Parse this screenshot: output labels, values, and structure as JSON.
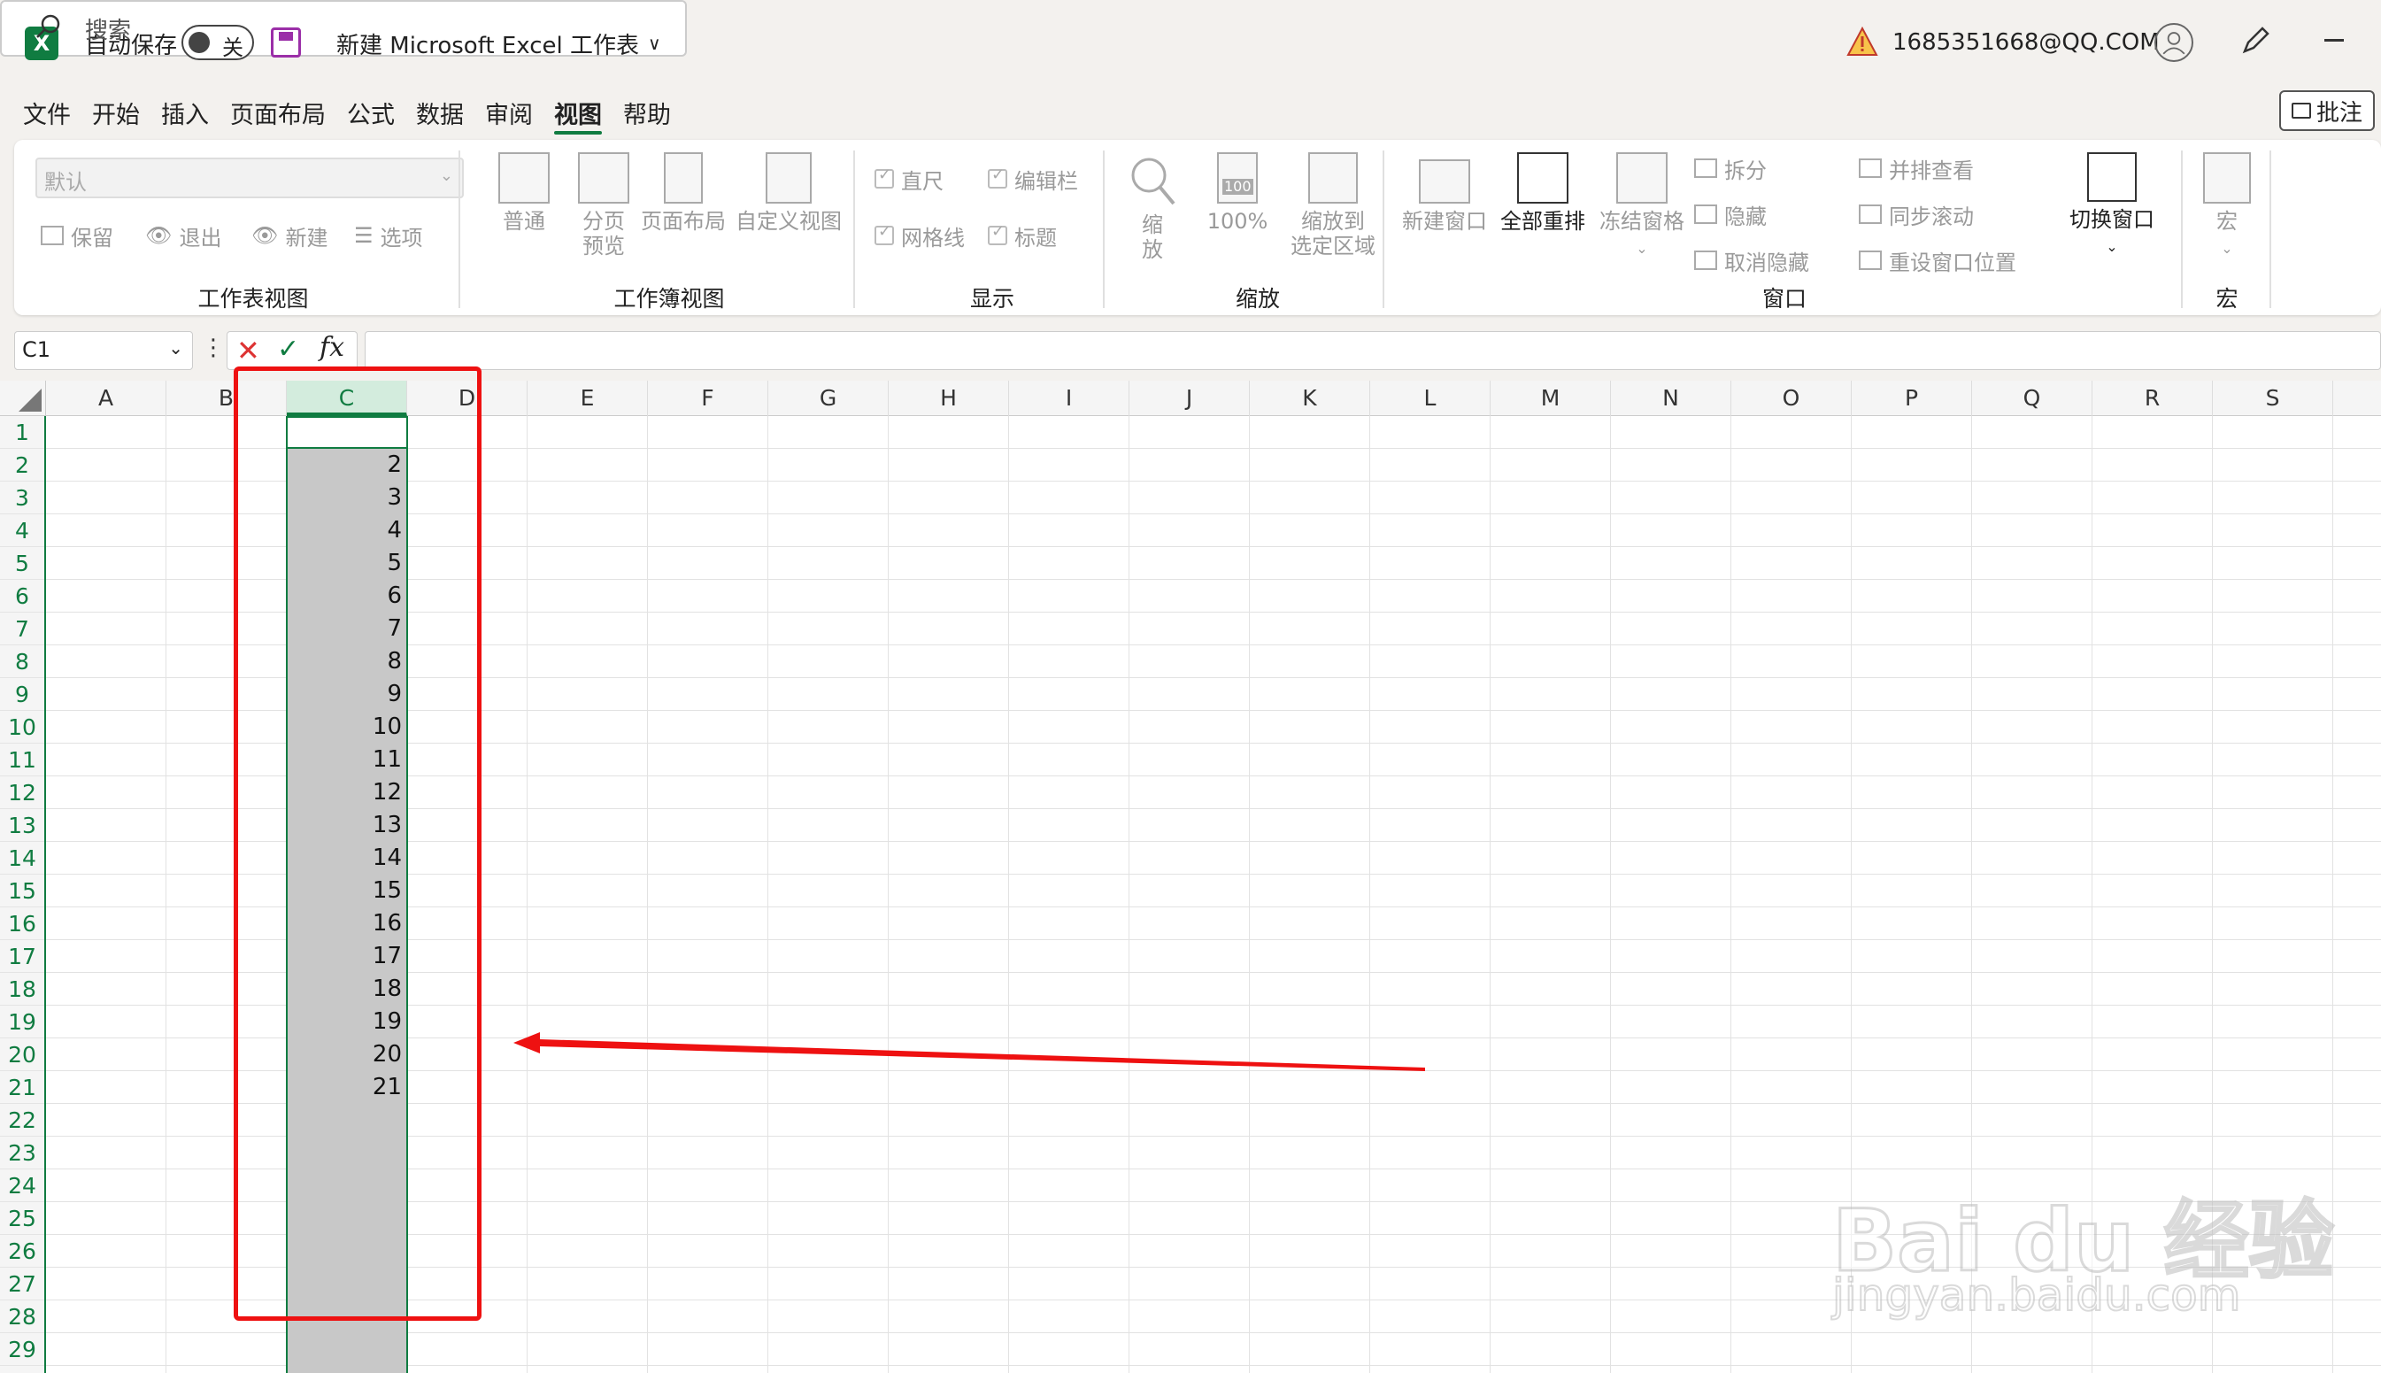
{
  "titlebar": {
    "autosave_label": "自动保存",
    "autosave_state": "关",
    "doc_title": "新建 Microsoft Excel 工作表",
    "doc_title_chevron": "∨",
    "search_placeholder": "搜索",
    "account_email": "1685351668@QQ.COM"
  },
  "tabs": [
    "文件",
    "开始",
    "插入",
    "页面布局",
    "公式",
    "数据",
    "审阅",
    "视图",
    "帮助"
  ],
  "active_tab": "视图",
  "comments_button": "批注",
  "ribbon": {
    "sheet_view": {
      "dropdown_value": "默认",
      "keep": "保留",
      "exit": "退出",
      "new": "新建",
      "options": "选项",
      "label": "工作表视图"
    },
    "workbook_view": {
      "normal": "普通",
      "page_break_1": "分页",
      "page_break_2": "预览",
      "page_layout": "页面布局",
      "custom_views": "自定义视图",
      "label": "工作簿视图"
    },
    "show": {
      "ruler": "直尺",
      "formula_bar": "编辑栏",
      "gridlines": "网格线",
      "headings": "标题",
      "label": "显示"
    },
    "zoom": {
      "zoom_1": "缩",
      "zoom_2": "放",
      "zoom_100": "100%",
      "zoom_icon_text": "100",
      "zoom_selection_1": "缩放到",
      "zoom_selection_2": "选定区域",
      "label": "缩放"
    },
    "window": {
      "new_window": "新建窗口",
      "arrange_all": "全部重排",
      "freeze_panes": "冻结窗格",
      "split": "拆分",
      "hide": "隐藏",
      "unhide": "取消隐藏",
      "side_by_side": "并排查看",
      "sync_scroll": "同步滚动",
      "reset_position": "重设窗口位置",
      "switch_windows": "切换窗口",
      "label": "窗口"
    },
    "macros": {
      "macros": "宏",
      "label": "宏"
    }
  },
  "formula_bar": {
    "name_box": "C1",
    "more": "⋮",
    "cancel": "✕",
    "enter": "✓",
    "fx": "fx",
    "value": ""
  },
  "grid": {
    "columns": [
      "A",
      "B",
      "C",
      "D",
      "E",
      "F",
      "G",
      "H",
      "I",
      "J",
      "K",
      "L",
      "M",
      "N",
      "O",
      "P",
      "Q",
      "R",
      "S"
    ],
    "selected_column": "C",
    "rows": [
      "1",
      "2",
      "3",
      "4",
      "5",
      "6",
      "7",
      "8",
      "9",
      "10",
      "11",
      "12",
      "13",
      "14",
      "15",
      "16",
      "17",
      "18",
      "19",
      "20",
      "21",
      "22",
      "23",
      "24",
      "25",
      "26",
      "27",
      "28",
      "29"
    ],
    "column_c_values": [
      "",
      "2",
      "3",
      "4",
      "5",
      "6",
      "7",
      "8",
      "9",
      "10",
      "11",
      "12",
      "13",
      "14",
      "15",
      "16",
      "17",
      "18",
      "19",
      "20",
      "21"
    ]
  },
  "watermark": {
    "main": "Bai du 经验",
    "sub": "jingyan.baidu.com"
  },
  "colors": {
    "accent": "#107c41",
    "annotation": "#ee1111",
    "selection_fill": "#c8c8c8"
  }
}
